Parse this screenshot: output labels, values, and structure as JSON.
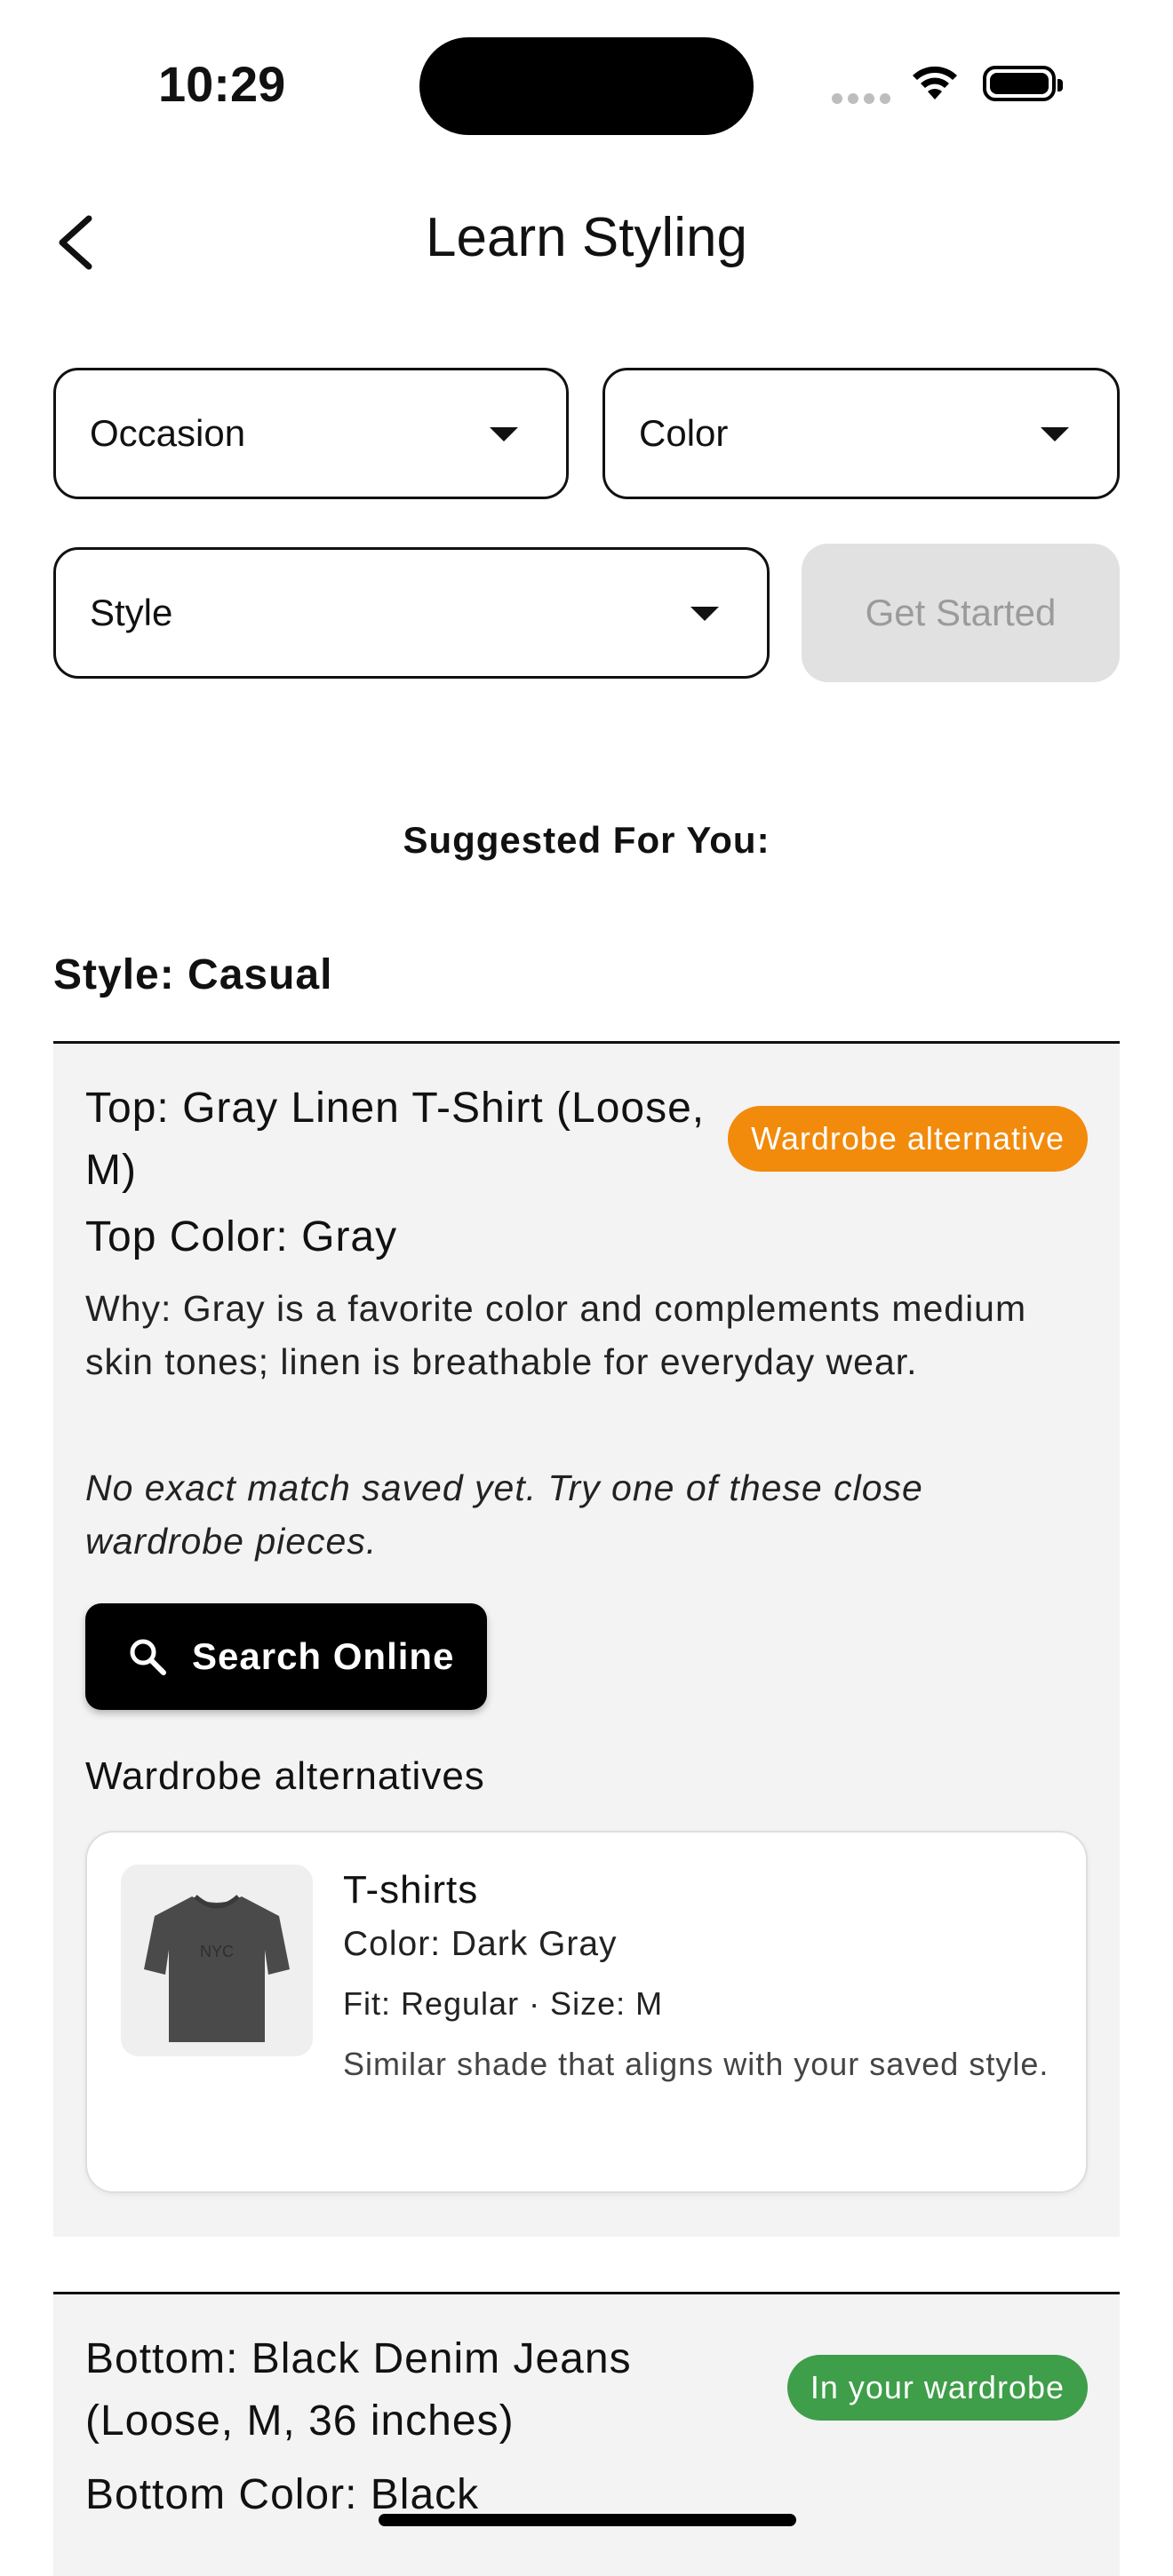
{
  "status": {
    "time": "10:29"
  },
  "nav": {
    "title": "Learn Styling"
  },
  "filters": {
    "occasion_label": "Occasion",
    "color_label": "Color",
    "style_label": "Style",
    "get_started_label": "Get Started"
  },
  "suggested_heading": "Suggested For You:",
  "style_section": "Style: Casual",
  "items": [
    {
      "title": "Top: Gray Linen T-Shirt (Loose, M)",
      "badge": "Wardrobe alternative",
      "color_line": "Top Color: Gray",
      "why": "Why: Gray is a favorite color and complements medium skin tones; linen is breathable for everyday wear.",
      "note": "No exact match saved yet. Try one of these close wardrobe pieces.",
      "search_label": "Search Online",
      "alternatives_heading": "Wardrobe alternatives",
      "alternative": {
        "name": "T-shirts",
        "color": "Color: Dark Gray",
        "fit": "Fit: Regular · Size: M",
        "description": "Similar shade that aligns with your saved style.",
        "shirt_print": "NYC"
      }
    },
    {
      "title": "Bottom: Black Denim Jeans (Loose, M, 36 inches)",
      "badge": "In your wardrobe",
      "color_line": "Bottom Color: Black"
    }
  ],
  "colors": {
    "badge_orange": "#f28a0b",
    "badge_green": "#3f9e49",
    "card_bg": "#f3f3f3",
    "disabled_button": "#e1e1e1"
  }
}
